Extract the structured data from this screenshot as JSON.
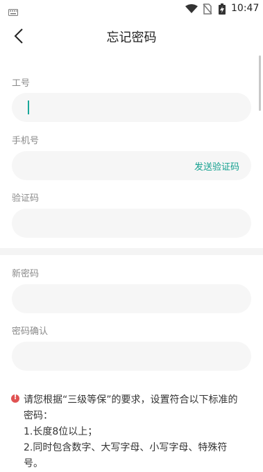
{
  "status_bar": {
    "time": "10:47",
    "icons": [
      "keyboard-icon",
      "wifi-icon",
      "no-sim-icon",
      "battery-charging-icon"
    ]
  },
  "nav": {
    "title": "忘记密码",
    "back_icon": "chevron-left-icon"
  },
  "form": {
    "employee_id": {
      "label": "工号",
      "value": ""
    },
    "phone": {
      "label": "手机号",
      "value": "",
      "send_code_label": "发送验证码"
    },
    "verify_code": {
      "label": "验证码",
      "value": ""
    },
    "new_password": {
      "label": "新密码",
      "value": ""
    },
    "confirm_password": {
      "label": "密码确认",
      "value": ""
    }
  },
  "notice": {
    "line1": "请您根据“三级等保”的要求，设置符合以下标准的",
    "line2": "密码：",
    "line3": "1.长度8位以上；",
    "line4": "2.同时包含数字、大写字母、小写字母、特殊符",
    "line5": "号。"
  },
  "colors": {
    "accent": "#13a08f",
    "field_bg": "#f6f6f6",
    "warning": "#e05252"
  }
}
